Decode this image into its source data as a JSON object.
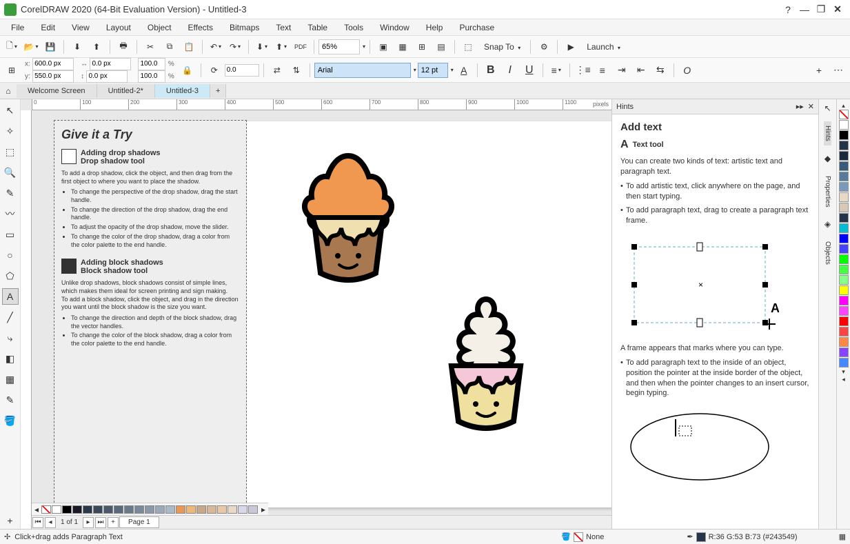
{
  "title": "CorelDRAW 2020 (64-Bit Evaluation Version) - Untitled-3",
  "menubar": [
    "File",
    "Edit",
    "View",
    "Layout",
    "Object",
    "Effects",
    "Bitmaps",
    "Text",
    "Table",
    "Tools",
    "Window",
    "Help",
    "Purchase"
  ],
  "toolbar1": {
    "zoom": "65%",
    "snap": "Snap To",
    "launch": "Launch"
  },
  "propbar": {
    "x": "600.0 px",
    "y": "550.0 px",
    "w": "0.0 px",
    "h": "0.0 px",
    "sx": "100.0",
    "sy": "100.0",
    "rotate": "0.0",
    "font": "Arial",
    "size": "12 pt"
  },
  "tabs": {
    "items": [
      "Welcome Screen",
      "Untitled-2*",
      "Untitled-3"
    ],
    "active": 2
  },
  "ruler": {
    "ticks": [
      "0",
      "100",
      "200",
      "300",
      "400",
      "500",
      "600",
      "700",
      "800",
      "900",
      "1000",
      "1100"
    ],
    "unit": "pixels"
  },
  "tryit": {
    "title": "Give it a Try",
    "sec1": {
      "h1": "Adding drop shadows",
      "h2": "Drop shadow tool",
      "p1": "To add a drop shadow, click the object, and then drag from the first object to where you want to place the shadow.",
      "li1": "To change the perspective of the drop shadow, drag the start handle.",
      "li2": "To change the direction of the drop shadow, drag the end handle.",
      "li3": "To adjust the opacity of the drop shadow, move the slider.",
      "li4": "To change the color of the drop shadow, drag a color from the color palette to the end handle."
    },
    "sec2": {
      "h1": "Adding block shadows",
      "h2": "Block shadow tool",
      "p1": "Unlike drop shadows, block shadows consist of simple lines, which makes them ideal for screen printing and sign making.",
      "p2": "To add a block shadow, click the object, and drag in the direction you want until the block shadow is the size you want.",
      "li1": "To change the direction and depth of the block shadow, drag the vector handles.",
      "li2": "To change the color of the block shadow, drag a color from the color palette to the end handle."
    }
  },
  "hints": {
    "header": "Hints",
    "title": "Add text",
    "tool": "Text tool",
    "p1": "You can create two kinds of text: artistic text and paragraph text.",
    "li1": "To add artistic text, click anywhere on the page, and then start typing.",
    "li2": "To add paragraph text, drag to create a paragraph text frame.",
    "p2": "A frame appears that marks where you can type.",
    "li3": "To add paragraph text to the inside of an object, position the pointer at the inside border of the object, and then when the pointer changes to an insert cursor, begin typing."
  },
  "rightTabs": [
    "Hints",
    "Properties",
    "Objects"
  ],
  "palette": [
    "#ffffff",
    "#000000",
    "#243549",
    "#1a2a3a",
    "#3a5a7a",
    "#5a7a9a",
    "#7a9aba",
    "#e8d8c8",
    "#d8c8b8",
    "#243549",
    "#00bcd4",
    "#0000ff",
    "#4444ff",
    "#00ff00",
    "#44ff44",
    "#88ff88",
    "#ffff00",
    "#ff00ff",
    "#ff44ff",
    "#ff0000",
    "#ff4444",
    "#ff8844",
    "#8844ff",
    "#4488ff"
  ],
  "bottomStrip": [
    "#ffffff",
    "#000000",
    "#1a1a2a",
    "#2a3a4a",
    "#3a4a5a",
    "#4a5a6a",
    "#5a6a7a",
    "#6a7a8a",
    "#7a8a9a",
    "#8a9aaa",
    "#9aaaba",
    "#aabac8",
    "#e89858",
    "#f0b878",
    "#c8a888",
    "#d8b898",
    "#e8c8a8",
    "#e8d8c8",
    "#d8d8e8",
    "#c8c8d8"
  ],
  "pagenav": {
    "info": "1 of 1",
    "page": "Page 1"
  },
  "status": {
    "left": "Click+drag adds Paragraph Text",
    "fill": "None",
    "rgb": "R:36 G:53 B:73 (#243549)"
  }
}
